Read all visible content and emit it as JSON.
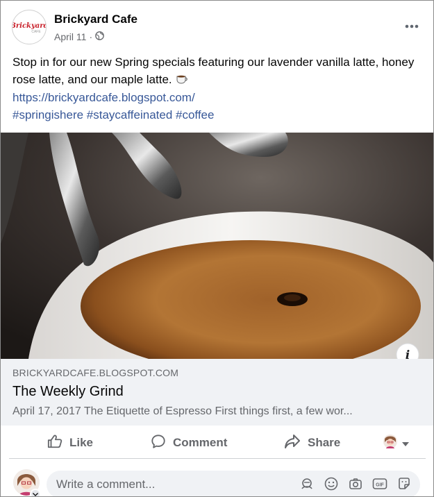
{
  "post": {
    "page_name": "Brickyard Cafe",
    "logo_text": "Brickyard",
    "logo_subtext": "CAFE",
    "date": "April 11",
    "separator": "·",
    "audience_icon": "globe-icon",
    "more_icon": "more-horizontal-icon",
    "text_line": "Stop in for our new Spring specials featuring our lavender vanilla latte, honey rose latte, and our maple latte.",
    "emoji_icon": "coffee-cup-emoji",
    "link_url": "https://brickyardcafe.blogspot.com/",
    "hashtags": "#springishere #staycaffeinated #coffee"
  },
  "preview": {
    "domain": "BRICKYARDCAFE.BLOGSPOT.COM",
    "title": "The Weekly Grind",
    "description": "April 17, 2017 The Etiquette of Espresso First things first, a few wor...",
    "info_icon": "info-icon",
    "info_label": "i"
  },
  "actions": {
    "like_label": "Like",
    "comment_label": "Comment",
    "share_label": "Share",
    "like_icon": "thumbs-up-icon",
    "comment_icon": "comment-icon",
    "share_icon": "share-arrow-icon",
    "switch_icon": "chevron-down-icon"
  },
  "composer": {
    "placeholder": "Write a comment...",
    "icons": [
      "avatar-sticker-icon",
      "emoji-icon",
      "camera-icon",
      "gif-icon",
      "sticker-icon"
    ],
    "gif_label": "GIF"
  },
  "colors": {
    "link": "#385898",
    "secondary_text": "#65676b",
    "preview_bg": "#f0f2f5",
    "logo_red": "#c8202a"
  }
}
